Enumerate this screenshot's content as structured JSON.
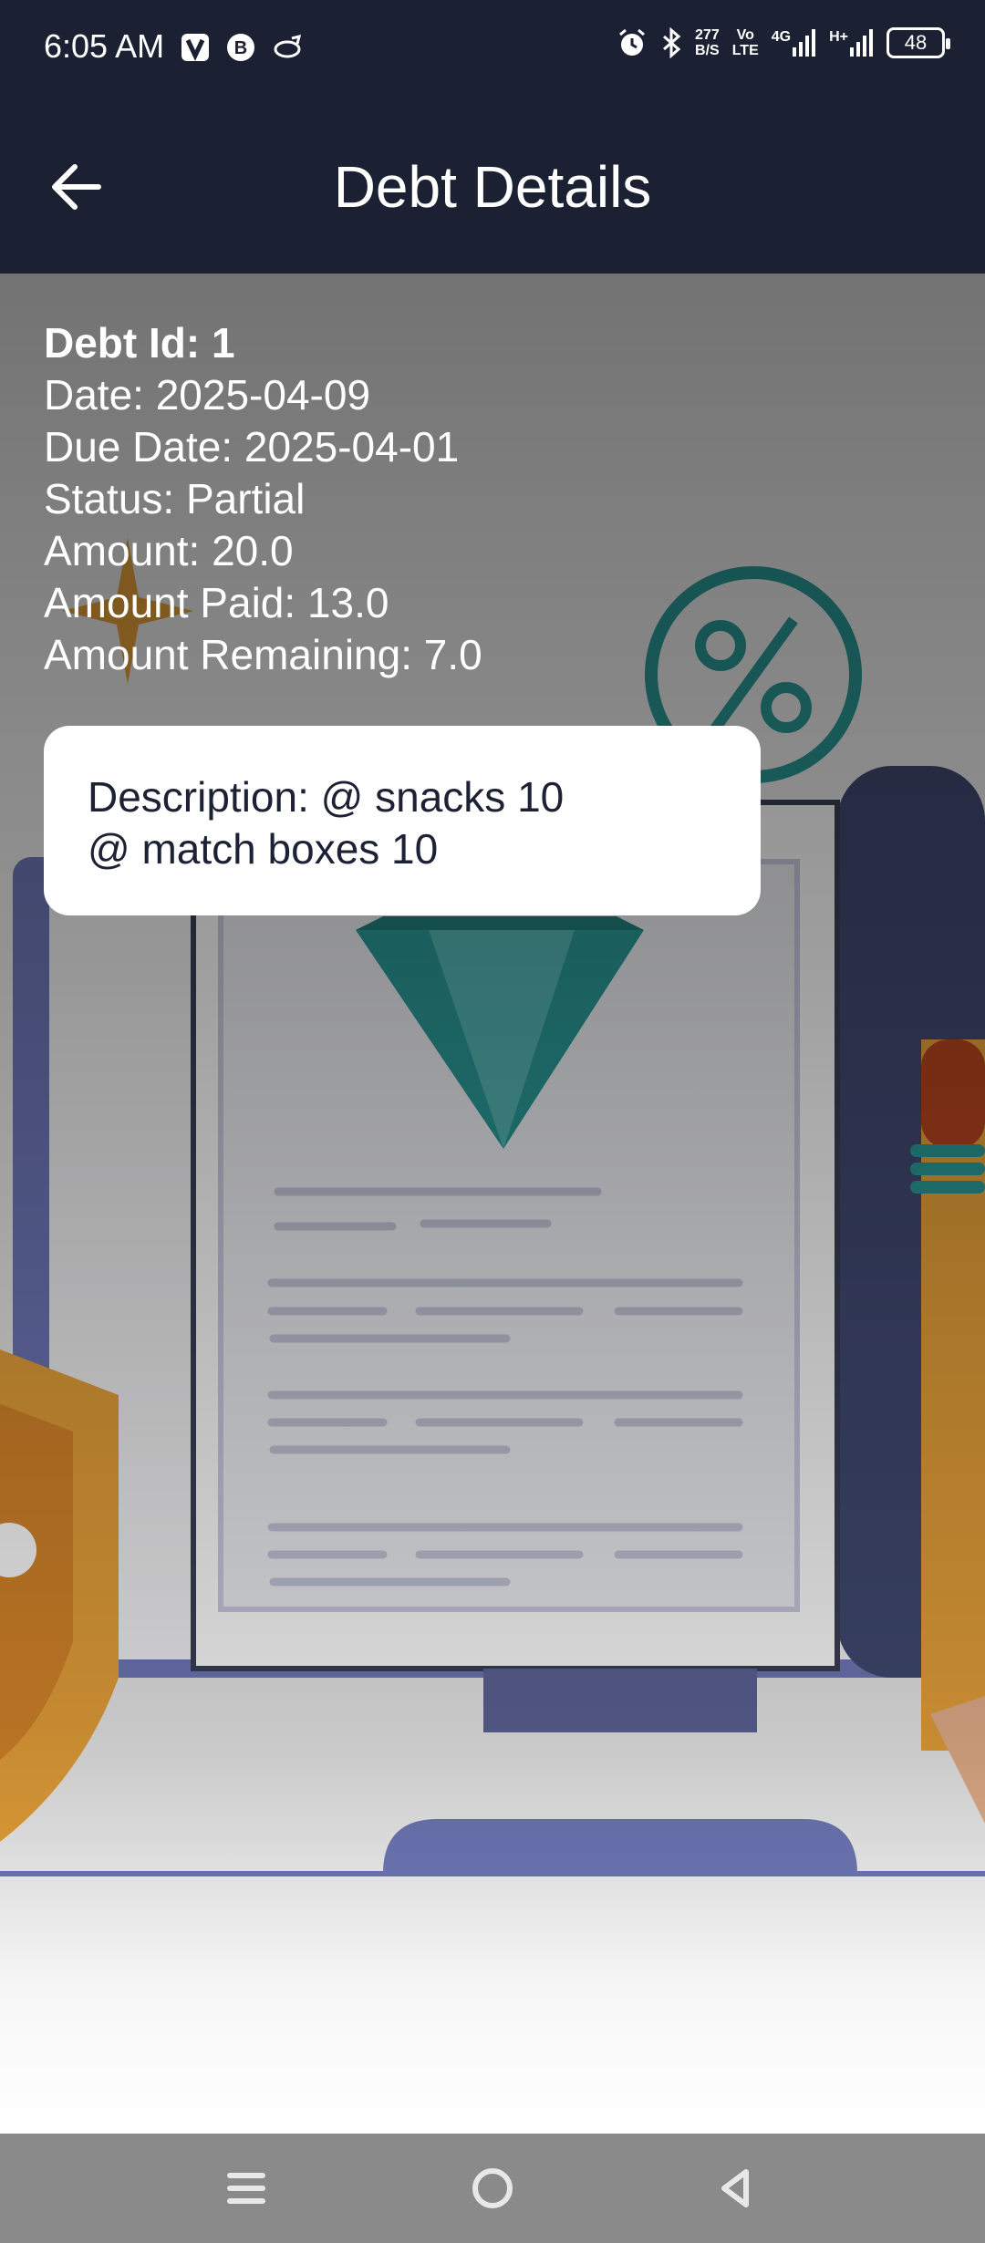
{
  "status_bar": {
    "time": "6:05 AM",
    "data_rate_top": "277",
    "data_rate_bottom": "B/S",
    "volte_top": "Vo",
    "volte_bottom": "LTE",
    "network_4g": "4G",
    "network_hplus": "H+",
    "battery": "48"
  },
  "app_bar": {
    "title": "Debt Details",
    "back_icon": "arrow-left-icon"
  },
  "debt": {
    "id_line": "Debt Id: 1",
    "date_line": "Date: 2025-04-09",
    "due_date_line": "Due Date: 2025-04-01",
    "status_line": "Status: Partial",
    "amount_line": "Amount: 20.0",
    "amount_paid_line": "Amount Paid: 13.0",
    "amount_remaining_line": "Amount Remaining: 7.0",
    "description": "Description: @ snacks 10\n@ match boxes 10"
  },
  "nav_bar": {
    "icons": [
      "menu-icon",
      "home-circle-icon",
      "back-triangle-icon"
    ]
  },
  "colors": {
    "app_bar": "#1b2132",
    "text_dark": "#1c2233",
    "teal": "#2a9a98",
    "purple": "#6f78b8",
    "orange": "#e8a23a"
  }
}
